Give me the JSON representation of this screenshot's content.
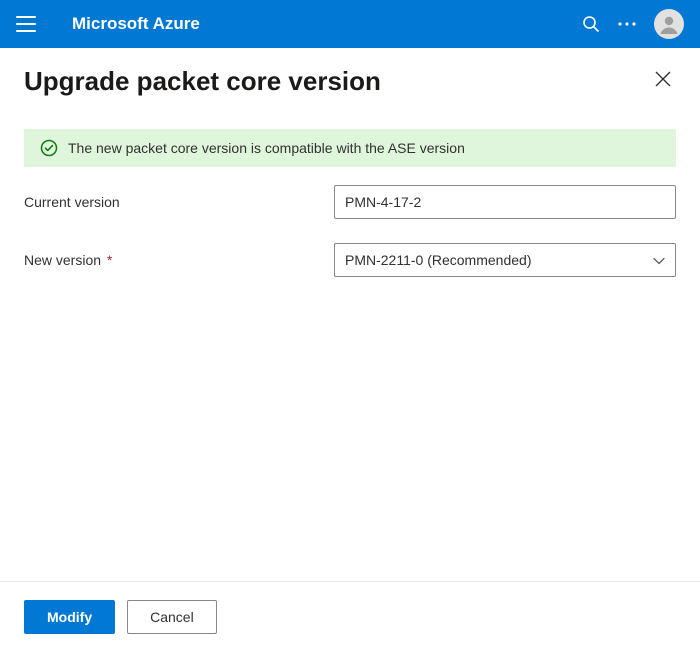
{
  "header": {
    "brand": "Microsoft Azure"
  },
  "page": {
    "title": "Upgrade packet core version"
  },
  "banner": {
    "message": "The new packet core version is compatible with the ASE version",
    "status_color": "#107c10"
  },
  "form": {
    "current_version": {
      "label": "Current version",
      "value": "PMN-4-17-2"
    },
    "new_version": {
      "label": "New version",
      "required_indicator": "*",
      "selected": "PMN-2211-0 (Recommended)"
    }
  },
  "footer": {
    "primary_label": "Modify",
    "secondary_label": "Cancel"
  }
}
